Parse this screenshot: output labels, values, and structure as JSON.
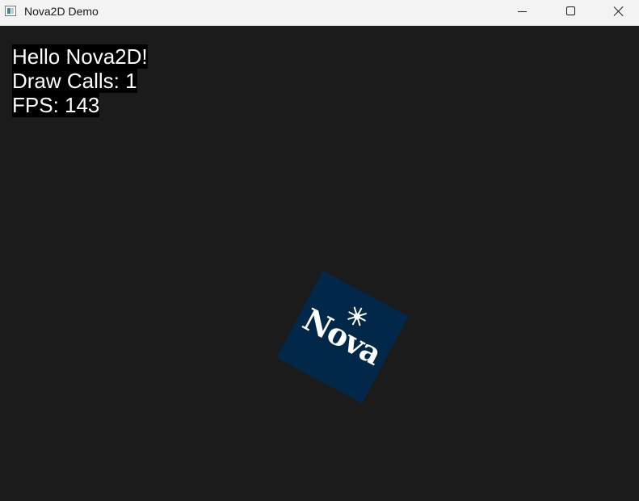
{
  "window": {
    "title": "Nova2D Demo",
    "controls": {
      "minimize_icon": "minimize-icon",
      "maximize_icon": "maximize-icon",
      "close_icon": "close-icon"
    }
  },
  "overlay": {
    "line1": "Hello Nova2D!",
    "line2": "Draw Calls: 1",
    "line3": "FPS: 143"
  },
  "sprite": {
    "logo_text": "Nova",
    "color": "#012848",
    "star_icon": "sparkle-icon"
  },
  "colors": {
    "background": "#1b1b1b",
    "titlebar": "#f3f3f3"
  }
}
